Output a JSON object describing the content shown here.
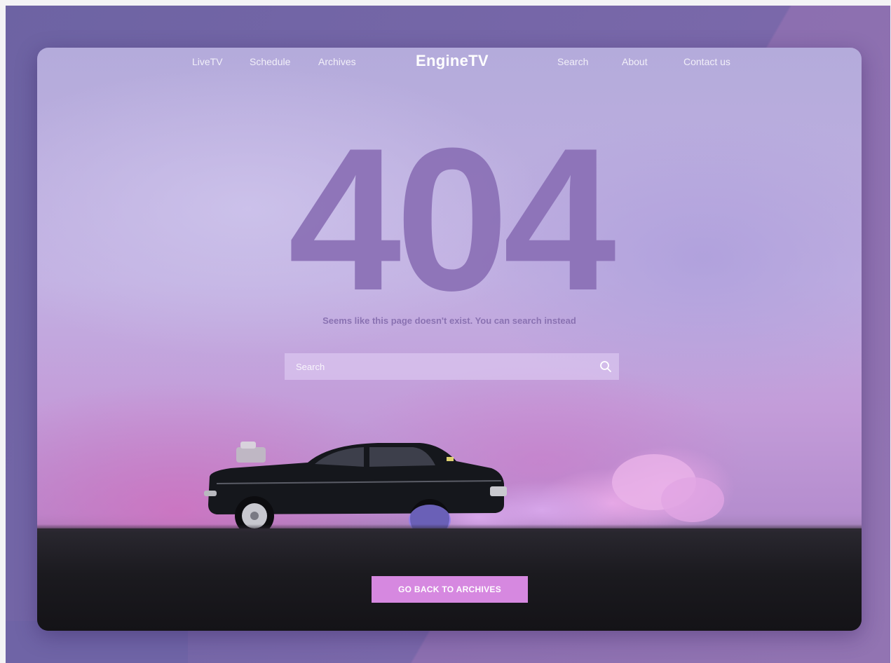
{
  "nav": {
    "left_links": [
      "LiveTV",
      "Schedule",
      "Archives"
    ],
    "brand": "EngineTV",
    "right_links": [
      "Search",
      "About",
      "Contact us"
    ]
  },
  "hero": {
    "code": "404",
    "message": "Seems  like this page doesn't exist.  You can search instead"
  },
  "search": {
    "placeholder": "Search",
    "icon": "search-icon"
  },
  "cta": {
    "label": "GO BACK TO ARCHIVES"
  },
  "colors": {
    "accent": "#d688e0",
    "code_color": "#8b70b6",
    "message_color": "#8a72b2"
  }
}
